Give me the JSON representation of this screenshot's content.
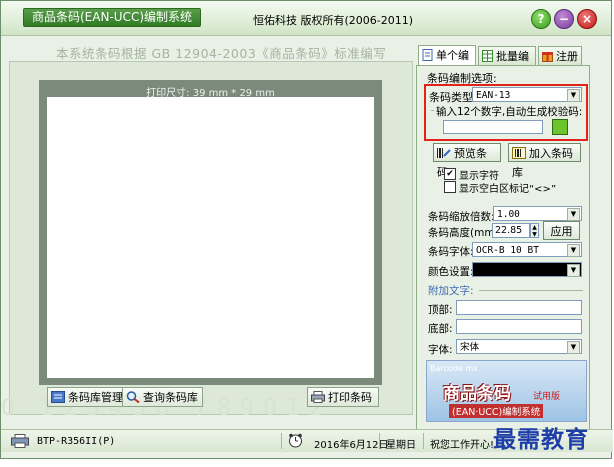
{
  "window": {
    "title": "商品条码(EAN-UCC)编制系统",
    "copyright": "恒佑科技  版权所有(2006-2011)",
    "help_label": "?",
    "min_label": "−",
    "close_label": "×"
  },
  "description": "本系统条码根据 GB 12904-2003《商品条码》标准编写",
  "canvas": {
    "print_size": "打印尺寸: 39 mm * 29 mm",
    "watermark": "0 123456 789012"
  },
  "left_buttons": {
    "library_manage": "条码库管理",
    "query_library": "查询条码库",
    "print": "打印条码"
  },
  "tabs": [
    {
      "label": "单个编制"
    },
    {
      "label": "批量编制"
    },
    {
      "label": "注册"
    }
  ],
  "options": {
    "section_title": "条码编制选项:",
    "type_label": "条码类型:",
    "type_value": "EAN-13",
    "input_hint": "输入12个数字,自动生成校验码:",
    "input_value": "",
    "check_color": "#6cc52e",
    "preview_button": "预览条码",
    "add_button": "加入条码库",
    "show_text_label": "显示字符",
    "show_text_checked": true,
    "show_blank_label": "显示空白区标记“<>”",
    "show_blank_checked": false,
    "scale_label": "条码缩放倍数:",
    "scale_value": "1.00",
    "height_label": "条码高度(mm):",
    "height_value": "22.85",
    "apply_button": "应用",
    "font_label": "条码字体:",
    "font_value": "OCR-B 10 BT",
    "color_label": "颜色设置:",
    "color_value": "#000000",
    "extra_text_title": "附加文字:",
    "top_label": "顶部:",
    "top_value": "",
    "bottom_label": "底部:",
    "bottom_value": "",
    "extra_font_label": "字体:",
    "extra_font_value": "宋体"
  },
  "ad": {
    "small": "Barcode mx",
    "big": "商品条码",
    "trial": "试用版",
    "sub": "(EAN·UCC)编制系统"
  },
  "status": {
    "printer": "BTP-R356II(P)",
    "date": "2016年6月12日",
    "weekday": "星期日",
    "message": "祝您工作开心!"
  },
  "brand_overlay": "最需教育"
}
